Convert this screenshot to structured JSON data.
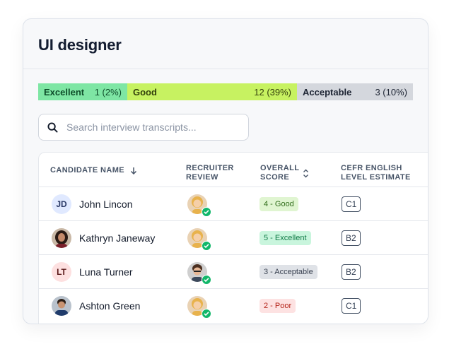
{
  "card": {
    "title": "UI designer"
  },
  "rating_bar": [
    {
      "label": "Excellent",
      "count": "1 (2%)"
    },
    {
      "label": "Good",
      "count": "12 (39%)"
    },
    {
      "label": "Acceptable",
      "count": "3 (10%)"
    }
  ],
  "search": {
    "placeholder": "Search interview transcripts..."
  },
  "table": {
    "headers": {
      "name": "CANDIDATE NAME",
      "review": "RECRUITER REVIEW",
      "score": "OVERALL SCORE",
      "cefr": "CEFR ENGLISH LEVEL ESTIMATE"
    },
    "rows": [
      {
        "initials": "JD",
        "name": "John Lincon",
        "score": "4 - Good",
        "cefr": "C1"
      },
      {
        "initials": "",
        "name": "Kathryn Janeway",
        "score": "5 - Excellent",
        "cefr": "B2"
      },
      {
        "initials": "LT",
        "name": "Luna Turner",
        "score": "3 - Acceptable",
        "cefr": "B2"
      },
      {
        "initials": "",
        "name": "Ashton Green",
        "score": "2 - Poor",
        "cefr": "C1"
      }
    ]
  },
  "colors": {
    "excellent": "#7ee6a4",
    "good": "#c7f261",
    "acceptable": "#d4d7dd",
    "poor": "#fde2e2",
    "check": "#12b76a"
  }
}
